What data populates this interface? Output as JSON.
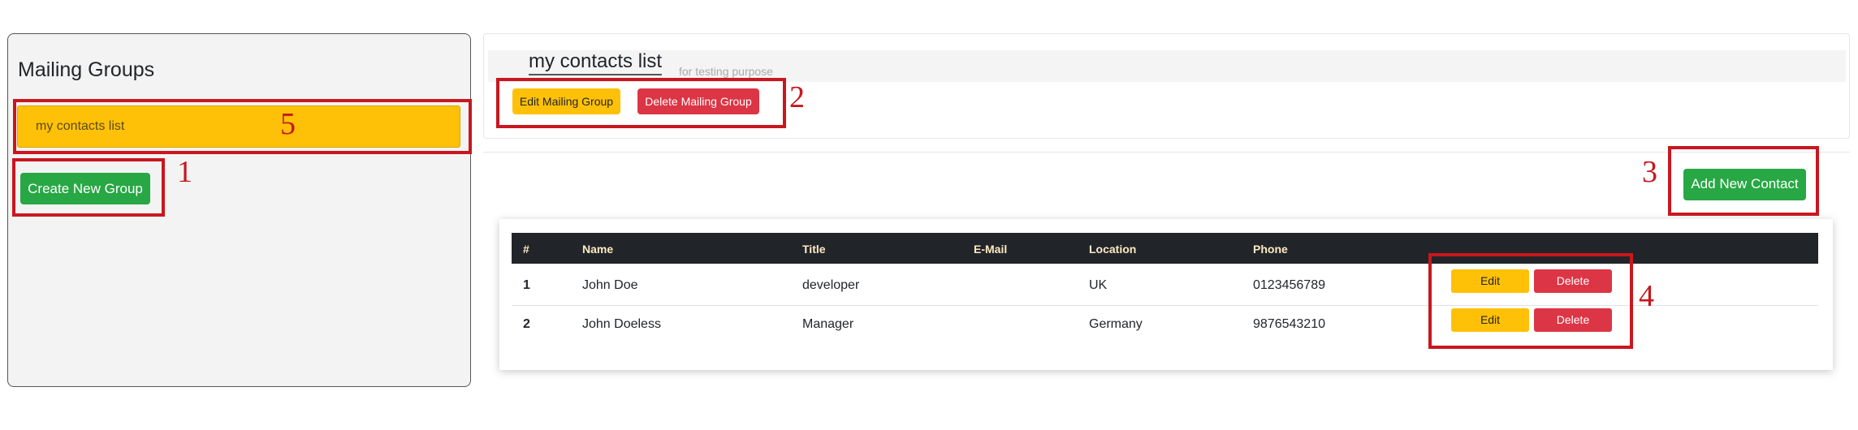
{
  "sidebar": {
    "title": "Mailing Groups",
    "groups": [
      {
        "label": "my contacts list"
      }
    ],
    "create_button": "Create New Group"
  },
  "group": {
    "name": "my contacts list",
    "description": "for testing purpose",
    "edit_button": "Edit Mailing Group",
    "delete_button": "Delete Mailing Group"
  },
  "contacts": {
    "add_button": "Add New Contact",
    "columns": [
      "#",
      "Name",
      "Title",
      "E-Mail",
      "Location",
      "Phone"
    ],
    "rows": [
      {
        "num": "1",
        "name": "John Doe",
        "title": "developer",
        "email": "",
        "location": "UK",
        "phone": "0123456789",
        "edit": "Edit",
        "delete": "Delete"
      },
      {
        "num": "2",
        "name": "John Doeless",
        "title": "Manager",
        "email": "",
        "location": "Germany",
        "phone": "9876543210",
        "edit": "Edit",
        "delete": "Delete"
      }
    ]
  },
  "annotations": [
    "1",
    "2",
    "3",
    "4",
    "5"
  ],
  "colors": {
    "annotation": "#c8171e",
    "primary_green": "#28a745",
    "warning_yellow": "#ffc107",
    "danger_red": "#dc3545",
    "table_header": "#212529"
  }
}
